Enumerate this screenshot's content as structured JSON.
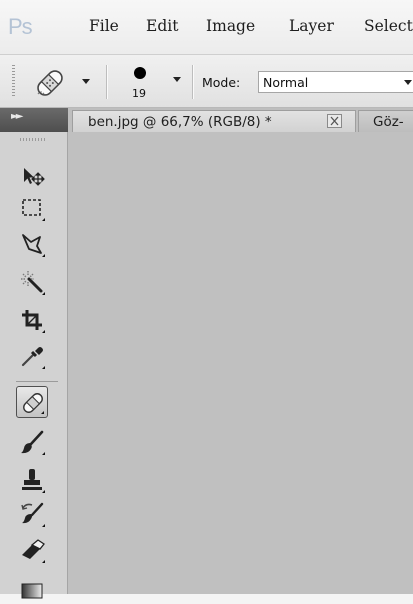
{
  "app": {
    "logo": "Ps"
  },
  "menu": {
    "items": [
      "File",
      "Edit",
      "Image",
      "Layer",
      "Select"
    ]
  },
  "options_bar": {
    "brush_size": "19",
    "mode_label": "Mode:",
    "mode_value": "Normal"
  },
  "tabs": [
    {
      "label": "ben.jpg @ 66,7% (RGB/8) *"
    },
    {
      "label": "Göz-"
    }
  ],
  "tools": [
    {
      "icon": "move-icon"
    },
    {
      "icon": "rectangular-marquee-icon"
    },
    {
      "icon": "polygonal-lasso-icon"
    },
    {
      "icon": "magic-wand-icon"
    },
    {
      "icon": "crop-icon"
    },
    {
      "icon": "eyedropper-icon"
    },
    {
      "icon": "spot-healing-brush-icon",
      "active": true
    },
    {
      "icon": "brush-icon"
    },
    {
      "icon": "clone-stamp-icon"
    },
    {
      "icon": "history-brush-icon"
    },
    {
      "icon": "eraser-icon"
    },
    {
      "icon": "gradient-icon"
    }
  ],
  "colors": {
    "canvas": "#c0c0c0",
    "panel": "#d2d2d2",
    "logo": "#b4c3d5"
  }
}
